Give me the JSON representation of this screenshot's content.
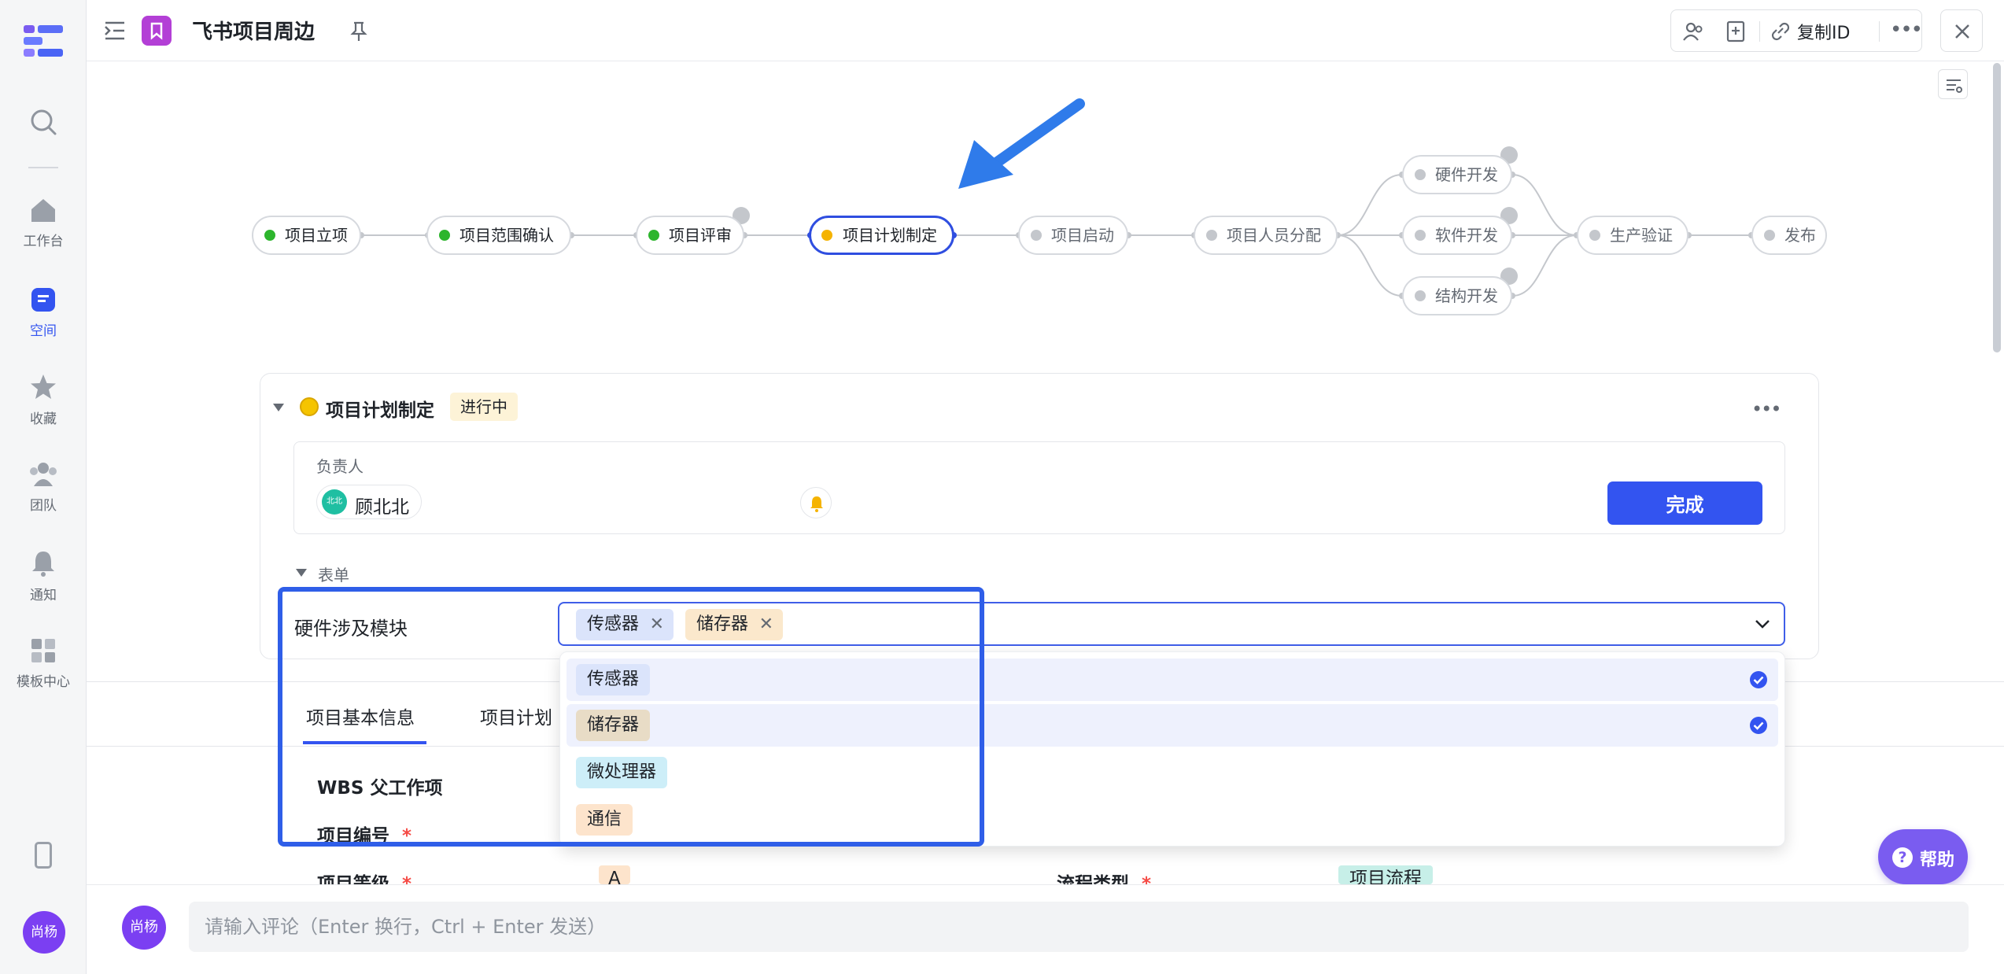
{
  "colors": {
    "accent": "#3354f0",
    "done_green": "#2db52d",
    "current_yellow": "#f5b300",
    "pending_grey": "#c4c7cc",
    "rail_bg": "#f5f6f7"
  },
  "rail": {
    "items": [
      {
        "label": "",
        "icon": "search-icon"
      },
      {
        "label": "工作台",
        "icon": "home-icon"
      },
      {
        "label": "空间",
        "icon": "space-icon",
        "active": true
      },
      {
        "label": "收藏",
        "icon": "star-icon"
      },
      {
        "label": "团队",
        "icon": "team-icon"
      },
      {
        "label": "通知",
        "icon": "bell-icon"
      },
      {
        "label": "模板中心",
        "icon": "grid-icon"
      }
    ],
    "user_avatar": "尚杨"
  },
  "header": {
    "title": "飞书项目周边",
    "copy_id_label": "复制ID"
  },
  "workflow": {
    "nodes": [
      {
        "label": "项目立项",
        "status": "done"
      },
      {
        "label": "项目范围确认",
        "status": "done"
      },
      {
        "label": "项目评审",
        "status": "done"
      },
      {
        "label": "项目计划制定",
        "status": "current"
      },
      {
        "label": "项目启动",
        "status": "pending"
      },
      {
        "label": "项目人员分配",
        "status": "pending"
      },
      {
        "label": "硬件开发",
        "status": "pending"
      },
      {
        "label": "软件开发",
        "status": "pending"
      },
      {
        "label": "结构开发",
        "status": "pending"
      },
      {
        "label": "生产验证",
        "status": "pending"
      },
      {
        "label": "发布",
        "status": "pending"
      }
    ]
  },
  "node_panel": {
    "title": "项目计划制定",
    "status_badge": "进行中",
    "assignee_label": "负责人",
    "assignee_name": "顾北北",
    "assignee_avatar": "北北",
    "done_button": "完成",
    "form_section": "表单"
  },
  "form": {
    "hardware_field_label": "硬件涉及模块",
    "selected_tags": [
      "传感器",
      "储存器"
    ],
    "options": [
      {
        "label": "传感器",
        "selected": true,
        "color": "#dbe4fb"
      },
      {
        "label": "储存器",
        "selected": true,
        "color": "#e8dcc6"
      },
      {
        "label": "微处理器",
        "selected": false,
        "color": "#cdeef8"
      },
      {
        "label": "通信",
        "selected": false,
        "color": "#fde4cc"
      }
    ]
  },
  "tabs": {
    "basic_info": "项目基本信息",
    "plan": "项目计划"
  },
  "fields": {
    "wbs_parent": "WBS 父工作项",
    "project_number": "项目编号",
    "project_level": "项目等级",
    "project_level_value": "A",
    "flow_type": "流程类型",
    "flow_type_value": "项目流程",
    "required_mark": "*"
  },
  "comment": {
    "avatar": "尚杨",
    "placeholder": "请输入评论（Enter 换行，Ctrl + Enter 发送）"
  },
  "help": {
    "label": "帮助"
  }
}
